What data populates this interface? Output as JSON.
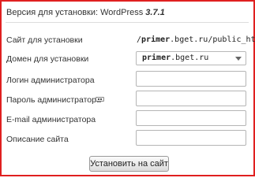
{
  "header": {
    "title": "Версия для установки: WordPress",
    "version": "3.7.1"
  },
  "form": {
    "install_path": {
      "label": "Сайт для установки",
      "prefix": "/",
      "bold": "primer",
      "rest": ".bget.ru/public_html"
    },
    "domain": {
      "label": "Домен для установки",
      "bold": "primer",
      "rest": ".bget.ru"
    },
    "admin_login": {
      "label": "Логин администратора",
      "value": ""
    },
    "admin_password": {
      "label": "Пароль администратора",
      "value": ""
    },
    "admin_email": {
      "label": "E-mail администратора",
      "value": ""
    },
    "site_description": {
      "label": "Описание сайта",
      "value": ""
    },
    "submit_label": "Установить на сайт"
  },
  "colors": {
    "frame_border": "#e02020"
  },
  "icons": {
    "password_icon": "keyboard-icon",
    "select_arrow": "chevron-down-icon"
  }
}
